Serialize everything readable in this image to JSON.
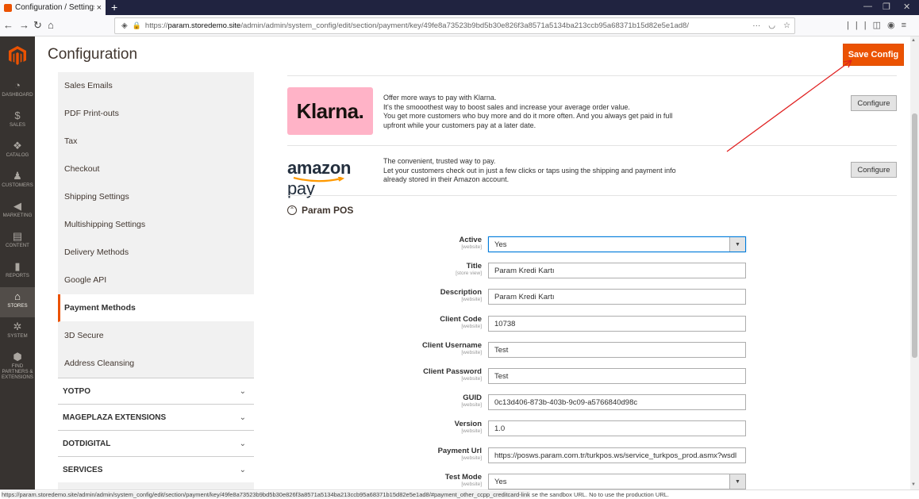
{
  "browser": {
    "tab_title": "Configuration / Settings / Stor",
    "tab_close": "×",
    "new_tab": "+",
    "url_domain": "param.storedemo.site",
    "url_prefix": "https://",
    "url_suffix": "/admin/admin/system_config/edit/section/payment/key/49fe8a73523b9bd5b30e826f3a8571a5134ba213ccb95a68371b15d82e5e1ad8/",
    "url_more": "···",
    "status_url": "https://param.storedemo.site/admin/admin/system_config/edit/section/payment/key/49fe8a73523b9bd5b30e826f3a8571a5134ba213ccb95a68371b15d82e5e1ad8/#payment_other_ccpp_creditcard-link",
    "status_tail": "se the sandbox URL. No to use the production URL."
  },
  "admin_nav": [
    {
      "label": "DASHBOARD",
      "icon": "dashboard-icon",
      "glyph": "◔"
    },
    {
      "label": "SALES",
      "icon": "dollar-icon",
      "glyph": "$"
    },
    {
      "label": "CATALOG",
      "icon": "box-icon",
      "glyph": "❖"
    },
    {
      "label": "CUSTOMERS",
      "icon": "person-icon",
      "glyph": "♟"
    },
    {
      "label": "MARKETING",
      "icon": "megaphone-icon",
      "glyph": "◀"
    },
    {
      "label": "CONTENT",
      "icon": "layout-icon",
      "glyph": "▤"
    },
    {
      "label": "REPORTS",
      "icon": "bar-chart-icon",
      "glyph": "▮"
    },
    {
      "label": "STORES",
      "icon": "store-icon",
      "glyph": "⌂"
    },
    {
      "label": "SYSTEM",
      "icon": "gear-icon",
      "glyph": "✲"
    },
    {
      "label": "FIND PARTNERS & EXTENSIONS",
      "icon": "cube-icon",
      "glyph": "⬢"
    }
  ],
  "header": {
    "title": "Configuration",
    "save_label": "Save Config"
  },
  "config_sidebar": {
    "items": [
      "Sales Emails",
      "PDF Print-outs",
      "Tax",
      "Checkout",
      "Shipping Settings",
      "Multishipping Settings",
      "Delivery Methods",
      "Google API",
      "Payment Methods",
      "3D Secure",
      "Address Cleansing"
    ],
    "active": "Payment Methods",
    "groups": [
      "YOTPO",
      "MAGEPLAZA EXTENSIONS",
      "DOTDIGITAL",
      "SERVICES"
    ]
  },
  "klarna": {
    "logo_text": "Klarna.",
    "desc": [
      "Offer more ways to pay with Klarna.",
      "It's the smooothest way to boost sales and increase your average order value.",
      "You get more customers who buy more and do it more often. And you always get paid in full",
      "upfront while your customers pay at a later date."
    ],
    "button": "Configure"
  },
  "amazon": {
    "logo_bold": "amazon",
    "logo_pay": "pay",
    "desc": [
      "The convenient, trusted way to pay.",
      "Let your customers check out in just a few clicks or taps using the shipping and payment info",
      "already stored in their Amazon account."
    ],
    "button": "Configure"
  },
  "section": {
    "title": "Param POS",
    "toggle": "⌃"
  },
  "fields": [
    {
      "label": "Active",
      "scope": "[website]",
      "value": "Yes",
      "type": "select"
    },
    {
      "label": "Title",
      "scope": "[store view]",
      "value": "Param Kredi Kartı",
      "type": "text"
    },
    {
      "label": "Description",
      "scope": "[website]",
      "value": "Param Kredi Kartı",
      "type": "text"
    },
    {
      "label": "Client Code",
      "scope": "[website]",
      "value": "10738",
      "type": "text"
    },
    {
      "label": "Client Username",
      "scope": "[website]",
      "value": "Test",
      "type": "text"
    },
    {
      "label": "Client Password",
      "scope": "[website]",
      "value": "Test",
      "type": "text"
    },
    {
      "label": "GUID",
      "scope": "[website]",
      "value": "0c13d406-873b-403b-9c09-a5766840d98c",
      "type": "text"
    },
    {
      "label": "Version",
      "scope": "[website]",
      "value": "1.0",
      "type": "text"
    },
    {
      "label": "Payment Url",
      "scope": "[website]",
      "value": "https://posws.param.com.tr/turkpos.ws/service_turkpos_prod.asmx?wsdl",
      "type": "text"
    },
    {
      "label": "Test Mode",
      "scope": "[website]",
      "value": "Yes",
      "type": "select"
    }
  ],
  "colors": {
    "accent": "#eb5202",
    "admin_nav_bg": "#373330",
    "klarna_pink": "#ffb3c7"
  }
}
